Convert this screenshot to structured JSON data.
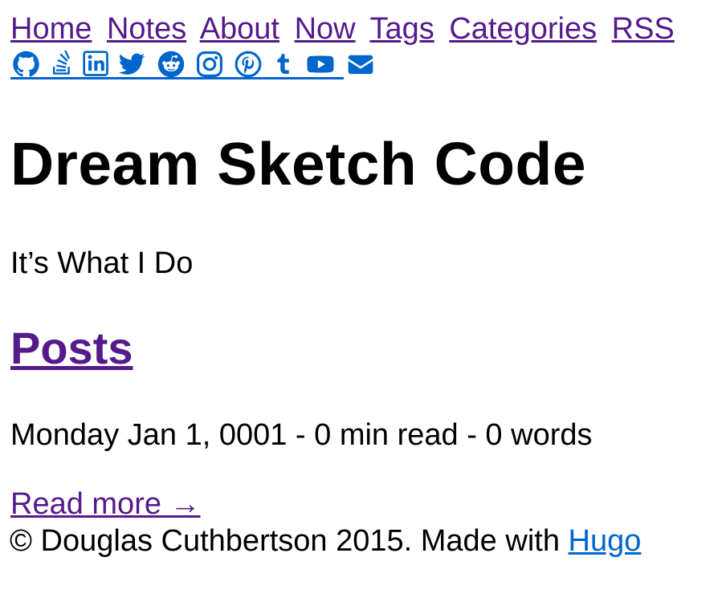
{
  "nav": {
    "items": [
      {
        "label": "Home"
      },
      {
        "label": "Notes"
      },
      {
        "label": "About"
      },
      {
        "label": "Now"
      },
      {
        "label": "Tags"
      },
      {
        "label": "Categories"
      },
      {
        "label": "RSS"
      }
    ]
  },
  "social": {
    "icons": [
      "github-icon",
      "stackoverflow-icon",
      "linkedin-icon",
      "twitter-icon",
      "reddit-icon",
      "instagram-icon",
      "pinterest-icon",
      "tumblr-icon",
      "youtube-icon",
      "envelope-icon"
    ],
    "color": "#0066cc"
  },
  "site": {
    "title": "Dream Sketch Code",
    "tagline": "It’s What I Do"
  },
  "posts": {
    "heading": "Posts",
    "meta": "Monday Jan 1, 0001 - 0 min read - 0 words",
    "read_more": "Read more →"
  },
  "footer": {
    "copyright": "© Douglas Cuthbertson 2015. Made with ",
    "hugo_link": "Hugo"
  },
  "colors": {
    "visited_link": "#551a8b",
    "link": "#0066cc",
    "text": "#000000",
    "background": "#ffffff"
  }
}
